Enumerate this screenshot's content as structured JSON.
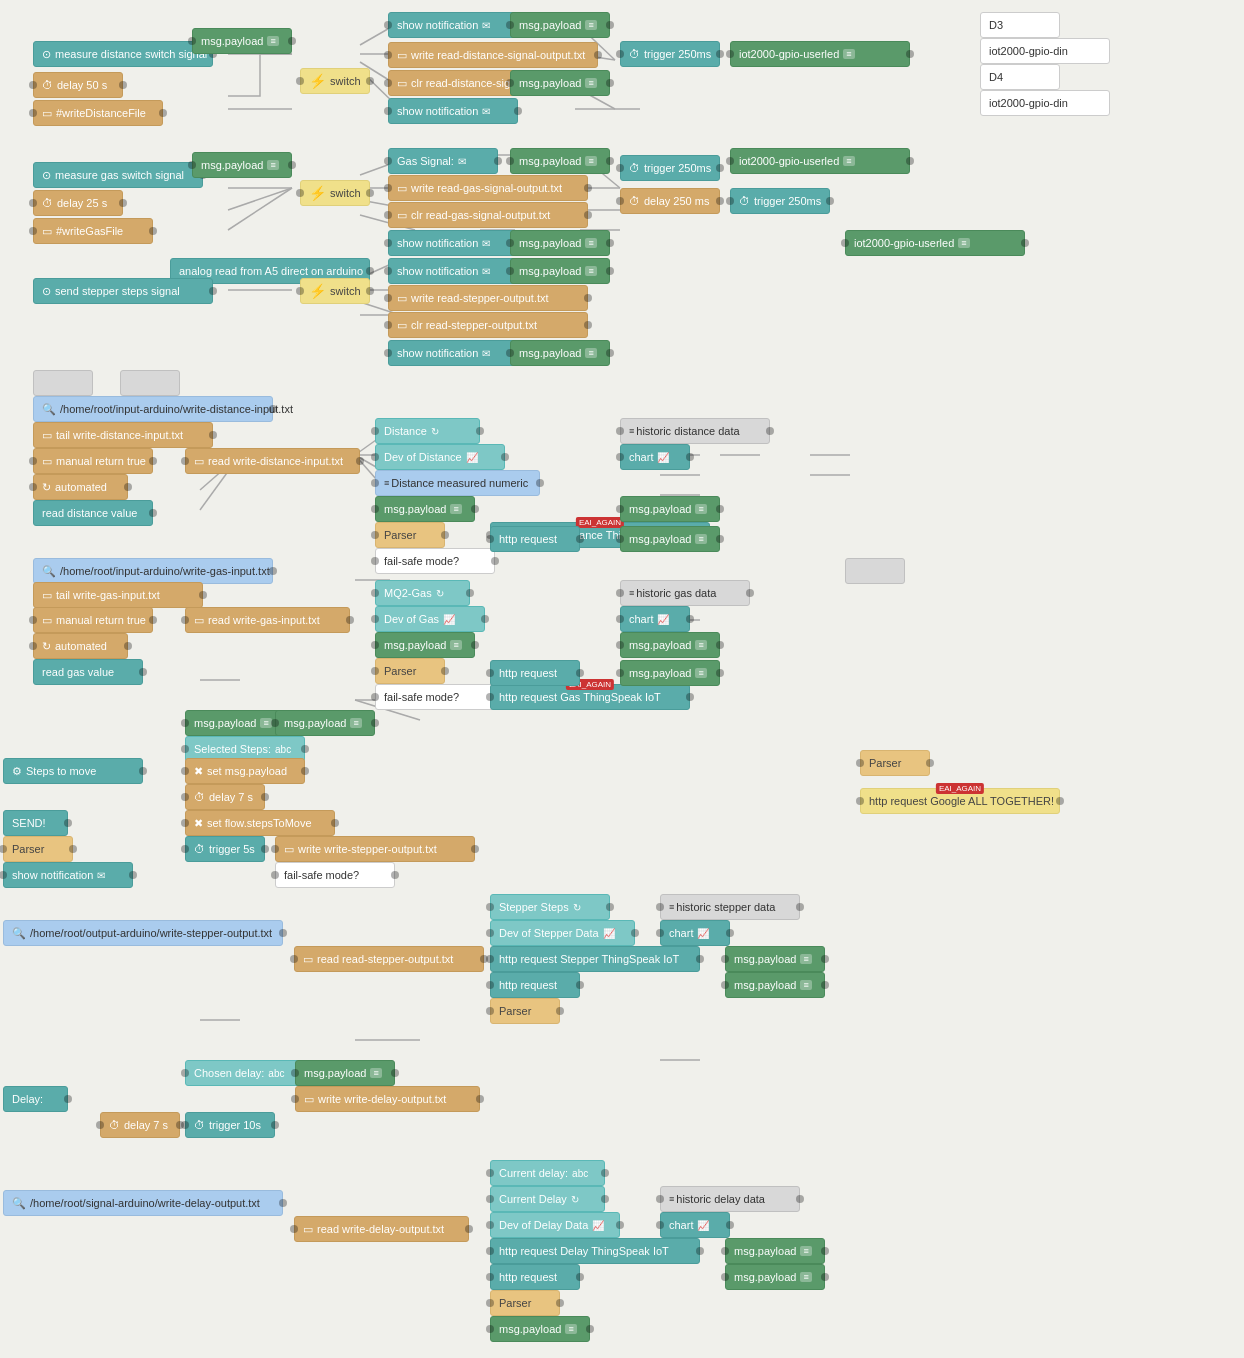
{
  "nodes": {
    "top_section": {
      "measure_distance": "measure distance switch signal",
      "delay_50": "delay 50 s",
      "write_distance_file": "#writeDistanceFile",
      "msg_payload_1": "msg.payload",
      "switch_1": "switch",
      "show_notif_1": "show notification",
      "write_read_dist": "write read-distance-signal-output.txt",
      "clr_read_dist": "clr read-distance-signal-output.txt",
      "msg_payload_2": "msg.payload",
      "trigger_250": "trigger 250ms",
      "show_notif_2": "show notification",
      "iot_gpio_1": "iot2000-gpio-userled",
      "d3": "D3",
      "iot_din_1": "iot2000-gpio-din",
      "d4": "D4",
      "iot_din_2": "iot2000-gpio-din",
      "measure_gas": "measure gas switch signal",
      "delay_25": "delay 25 s",
      "write_gas_file": "#writeGasFile",
      "msg_payload_3": "msg.payload",
      "switch_2": "switch",
      "gas_signal": "Gas Signal:",
      "write_read_gas": "write read-gas-signal-output.txt",
      "clr_read_gas": "clr read-gas-signal-output.txt",
      "msg_payload_4": "msg.payload",
      "trigger_250_2": "trigger 250ms",
      "show_notif_gas": "show notification",
      "iot_gpio_2": "iot2000-gpio-userled",
      "delay_250": "delay 250 ms",
      "trigger_250_3": "trigger 250ms",
      "iot_gpio_3": "iot2000-gpio-userled",
      "analog_read": "analog read from A5 direct on arduino",
      "send_stepper": "send stepper steps signal",
      "switch_3": "switch",
      "show_notif_3": "show notification",
      "write_stepper": "write read-stepper-output.txt",
      "clr_stepper": "clr read-stepper-output.txt",
      "msg_payload_5": "msg.payload",
      "show_notif_4": "show notification",
      "msg_payload_6": "msg.payload"
    },
    "mid_section": {
      "blank1": "",
      "blank2": "",
      "path_write_dist": "/home/root/input-arduino/write-distance-input.txt",
      "tail_write_dist": "tail write-distance-input.txt",
      "manual_true_1": "manual return true",
      "automated_1": "automated",
      "read_dist_val": "read distance value",
      "read_write_dist": "read write-distance-input.txt",
      "distance_node": "Distance",
      "dev_distance": "Dev of Distance",
      "dist_numeric": "Distance measured numeric",
      "msg_payload_mid1": "msg.payload",
      "parser_1": "Parser",
      "fail_safe_1": "fail-safe mode?",
      "http_req_dist": "http request Distance ThingSpeak IoT",
      "eai_again_1": "EAI_AGAIN",
      "http_req_1": "http request",
      "msg_payload_m2": "msg.payload",
      "msg_payload_m3": "msg.payload",
      "historic_dist": "historic distance data",
      "chart_1": "chart",
      "path_write_gas": "/home/root/input-arduino/write-gas-input.txt",
      "tail_write_gas": "tail write-gas-input.txt",
      "manual_true_2": "manual return true",
      "automated_2": "automated",
      "read_gas_val": "read gas value",
      "read_write_gas": "read write-gas-input.txt",
      "mq2_gas": "MQ2-Gas",
      "dev_gas": "Dev of Gas",
      "msg_payload_g1": "msg.payload",
      "parser_2": "Parser",
      "fail_safe_2": "fail-safe mode?",
      "http_req_gas": "http request Gas ThingSpeak IoT",
      "eai_again_2": "EAI_AGAIN",
      "http_req_2": "http request",
      "msg_payload_g2": "msg.payload",
      "msg_payload_g3": "msg.payload",
      "historic_gas": "historic gas data",
      "chart_2": "chart",
      "blank3": "",
      "selected_steps": "Selected Steps:",
      "steps_move": "Steps to move",
      "set_msg_payload": "set msg.payload",
      "delay_7": "delay 7 s",
      "set_flow": "set flow.stepsToMove",
      "send_btn": "SEND!",
      "parser_3": "Parser",
      "trigger_5s": "trigger 5s",
      "fail_safe_3": "fail-safe mode?",
      "write_stepper_out": "write write-stepper-output.txt",
      "show_notif_5": "show notification",
      "msg_payload_s1": "msg.payload",
      "msg_payload_s2": "msg.payload",
      "http_req_google": "http request Google ALL TOGETHER!",
      "eai_again_g": "EAI_AGAIN",
      "parser_g": "Parser",
      "stepper_steps": "Stepper Steps",
      "dev_stepper": "Dev of Stepper Data",
      "historic_stepper": "historic stepper data",
      "chart_3": "chart",
      "http_req_stepper": "http request Stepper ThingSpeak IoT",
      "http_req_s2": "http request",
      "msg_payload_s3": "msg.payload",
      "msg_payload_s4": "msg.payload",
      "path_stepper_out": "/home/root/output-arduino/write-stepper-output.txt",
      "read_stepper_out": "read read-stepper-output.txt",
      "parser_4": "Parser"
    },
    "bot_section": {
      "chosen_delay": "Chosen delay:",
      "delay_input": "Delay:",
      "delay_7b": "delay 7 s",
      "trigger_10s": "trigger 10s",
      "write_delay_out": "write write-delay-output.txt",
      "path_delay": "/home/root/signal-arduino/write-delay-output.txt",
      "read_delay_out": "read write-delay-output.txt",
      "msg_payload_b1": "msg.payload",
      "current_delay_abc": "Current delay:",
      "current_delay": "Current Delay",
      "dev_delay": "Dev of Delay Data",
      "historic_delay": "historic delay data",
      "chart_4": "chart",
      "http_req_delay": "http request Delay ThingSpeak IoT",
      "http_req_d2": "http request",
      "msg_payload_d1": "msg.payload",
      "msg_payload_d2": "msg.payload",
      "parser_5": "Parser",
      "msg_payload_b2": "msg.payload"
    }
  },
  "colors": {
    "green_dk": "#5a9a6a",
    "teal": "#5aacaa",
    "orange": "#d4a96a",
    "yellow": "#f0e08a",
    "blue_lt": "#aaccee",
    "gray": "#d8d8d8",
    "white": "#ffffff",
    "red": "#cc3333"
  }
}
